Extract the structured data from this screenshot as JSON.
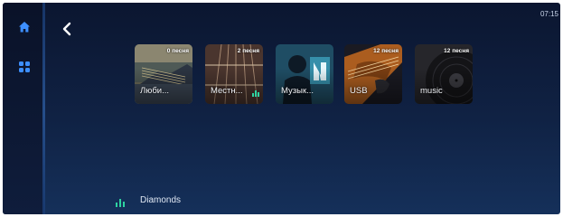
{
  "status": {
    "time": "07:15"
  },
  "sidebar": {
    "items": [
      {
        "icon": "home-icon"
      },
      {
        "icon": "grid-icon"
      }
    ]
  },
  "nav": {
    "back_icon": "back-chevron-icon"
  },
  "tiles": [
    {
      "label": "Люби...",
      "count": "0 песня",
      "playing": false
    },
    {
      "label": "Местн...",
      "count": "2 песня",
      "playing": true
    },
    {
      "label": "Музык...",
      "count": "",
      "playing": false
    },
    {
      "label": "USB",
      "count": "12 песня",
      "playing": false
    },
    {
      "label": "music",
      "count": "12 песня",
      "playing": false
    }
  ],
  "now_playing": {
    "title": "Diamonds"
  },
  "colors": {
    "accent": "#2f8fff",
    "playing": "#2ed3a1",
    "background": "#102244"
  }
}
